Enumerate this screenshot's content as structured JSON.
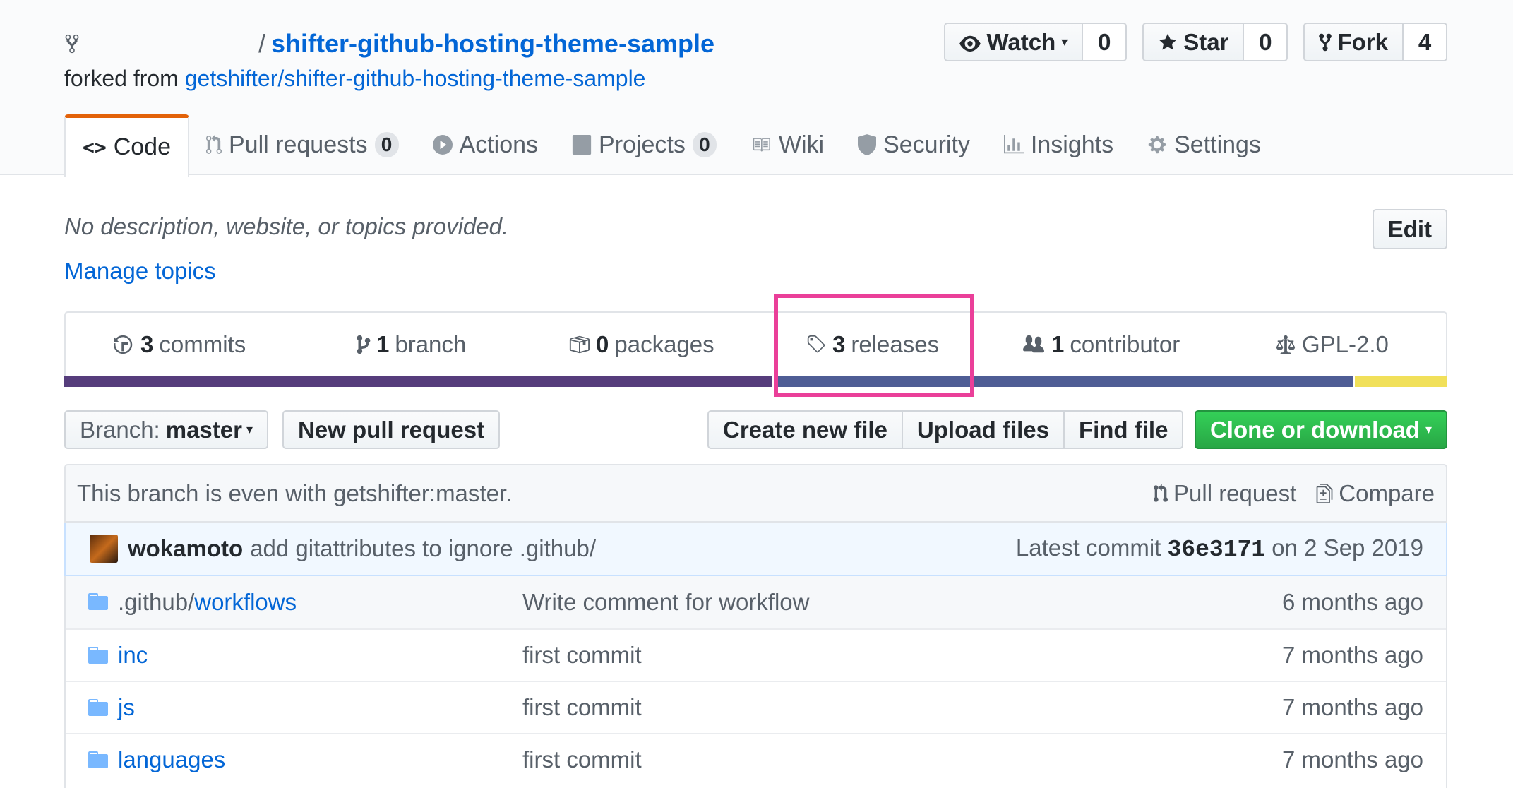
{
  "repo": {
    "separator": "/",
    "name": "shifter-github-hosting-theme-sample",
    "forked_from_prefix": "forked from",
    "forked_from": "getshifter/shifter-github-hosting-theme-sample"
  },
  "actions": {
    "watch_label": "Watch",
    "watch_count": "0",
    "star_label": "Star",
    "star_count": "0",
    "fork_label": "Fork",
    "fork_count": "4"
  },
  "nav": {
    "tabs": [
      {
        "label": "Code",
        "selected": true
      },
      {
        "label": "Pull requests",
        "counter": "0"
      },
      {
        "label": "Actions"
      },
      {
        "label": "Projects",
        "counter": "0"
      },
      {
        "label": "Wiki"
      },
      {
        "label": "Security"
      },
      {
        "label": "Insights"
      },
      {
        "label": "Settings"
      }
    ]
  },
  "description": {
    "text": "No description, website, or topics provided.",
    "manage_topics": "Manage topics",
    "edit_label": "Edit"
  },
  "summary": {
    "commits": {
      "num": "3",
      "label": "commits"
    },
    "branch": {
      "num": "1",
      "label": "branch"
    },
    "packages": {
      "num": "0",
      "label": "packages"
    },
    "releases": {
      "num": "3",
      "label": "releases"
    },
    "contributors": {
      "num": "1",
      "label": "contributor"
    },
    "license": "GPL-2.0",
    "language_colors": [
      "#563d7c",
      "#4F5D95",
      "#f1e05a"
    ],
    "language_fractions": [
      0.512,
      0.42,
      0.068
    ],
    "highlight_color": "#ea3f99"
  },
  "file_nav": {
    "branch_prefix": "Branch:",
    "branch_name": "master",
    "new_pr": "New pull request",
    "create_file": "Create new file",
    "upload_files": "Upload files",
    "find_file": "Find file",
    "clone": "Clone or download"
  },
  "branch_info": {
    "text": "This branch is even with getshifter:master.",
    "pull_request": "Pull request",
    "compare": "Compare"
  },
  "commit": {
    "author": "wokamoto",
    "message": "add gitattributes to ignore .github/",
    "latest_prefix": "Latest commit",
    "sha": "36e3171",
    "date": "on 2 Sep 2019"
  },
  "files": [
    {
      "prefix": ".github/",
      "name": "workflows",
      "message": "Write comment for workflow",
      "age": "6 months ago"
    },
    {
      "prefix": "",
      "name": "inc",
      "message": "first commit",
      "age": "7 months ago"
    },
    {
      "prefix": "",
      "name": "js",
      "message": "first commit",
      "age": "7 months ago"
    },
    {
      "prefix": "",
      "name": "languages",
      "message": "first commit",
      "age": "7 months ago"
    }
  ]
}
